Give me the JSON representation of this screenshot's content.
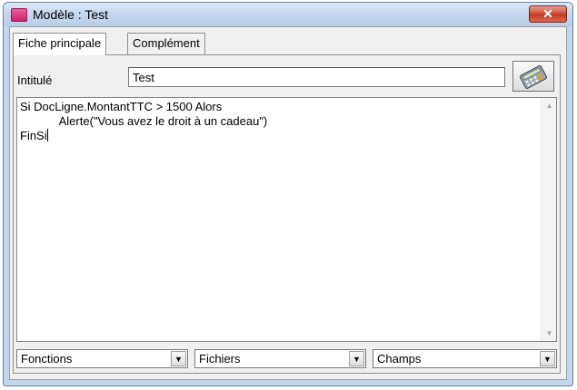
{
  "window": {
    "title": "Modèle : Test",
    "close_glyph": "✕"
  },
  "tabs": [
    {
      "label": "Fiche principale",
      "active": true
    },
    {
      "label": "Complément",
      "active": false
    }
  ],
  "form": {
    "intitule_label": "Intitulé",
    "intitule_value": "Test"
  },
  "editor": {
    "lines": [
      "Si DocLigne.MontantTTC > 1500 Alors",
      "            Alerte(\"Vous avez le droit à un cadeau\")",
      "FinSi"
    ],
    "scroll_up": "▲",
    "scroll_down": "▼"
  },
  "combos": [
    {
      "value": "Fonctions",
      "arrow": "▼"
    },
    {
      "value": "Fichiers",
      "arrow": "▼"
    },
    {
      "value": "Champs",
      "arrow": "▼"
    }
  ],
  "icons": {
    "calc_button": "calculator-icon",
    "app": "app-icon"
  },
  "colors": {
    "frame": "#c4d6ec",
    "close": "#c23a22",
    "app_icon": "#e0307e"
  }
}
